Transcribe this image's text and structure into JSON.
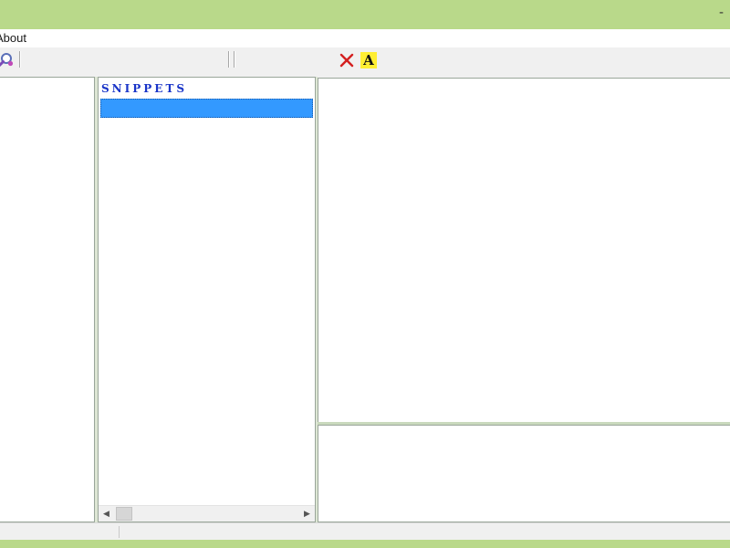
{
  "window": {
    "title_control_glyph": "-"
  },
  "menubar": {
    "items": [
      {
        "label": "About"
      }
    ]
  },
  "toolbar": {
    "icons": [
      {
        "name": "search-icon"
      },
      {
        "name": "delete-icon",
        "color": "#d42020"
      },
      {
        "name": "font-icon",
        "glyph": "A",
        "background": "#ffee33"
      }
    ]
  },
  "snippets_panel": {
    "header": "SNIPPETS",
    "selected_item": ""
  },
  "colors": {
    "frame": "#b9d98a",
    "selection": "#3399ff",
    "header_text": "#1a35c8"
  }
}
